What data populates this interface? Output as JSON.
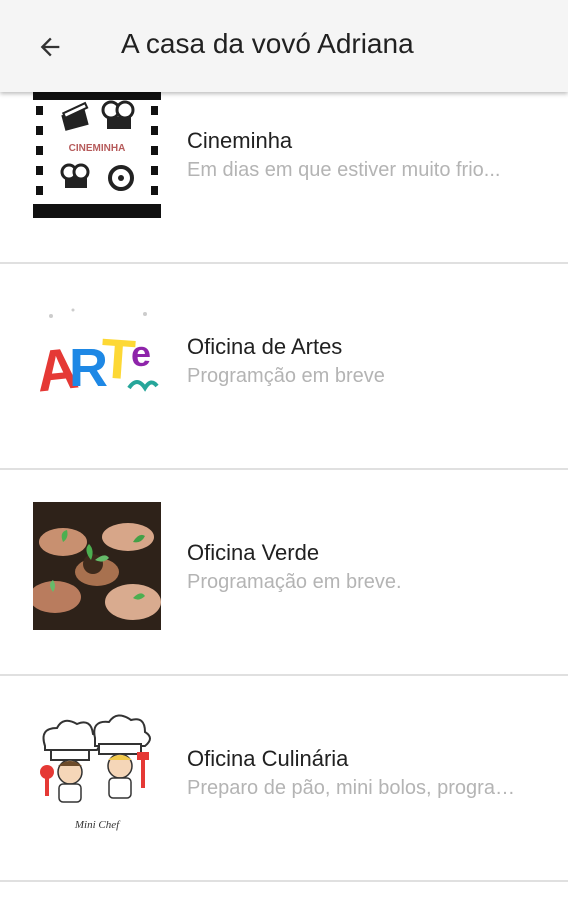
{
  "appbar": {
    "back_icon": "arrow-left-icon",
    "title": "A casa da vovó Adriana"
  },
  "items": [
    {
      "name": "Cineminha",
      "description": "Em dias em que estiver muito frio...",
      "image_label": "CINEMINHA",
      "icon": "film-reel-icon"
    },
    {
      "name": "Oficina de Artes",
      "description": "Programção em breve",
      "image_label": "ARTE",
      "icon": "art-logo-icon"
    },
    {
      "name": "Oficina Verde",
      "description": "Programação em breve.",
      "icon": "hands-plants-icon"
    },
    {
      "name": "Oficina Culinária",
      "description": "Preparo de pão, mini bolos, programação...",
      "image_label": "Mini Chef",
      "icon": "chef-kids-icon"
    }
  ],
  "colors": {
    "appbar_bg": "#f5f5f5",
    "title_text": "#212121",
    "secondary_text": "#b4b4b4",
    "divider": "#e0e0e0"
  }
}
